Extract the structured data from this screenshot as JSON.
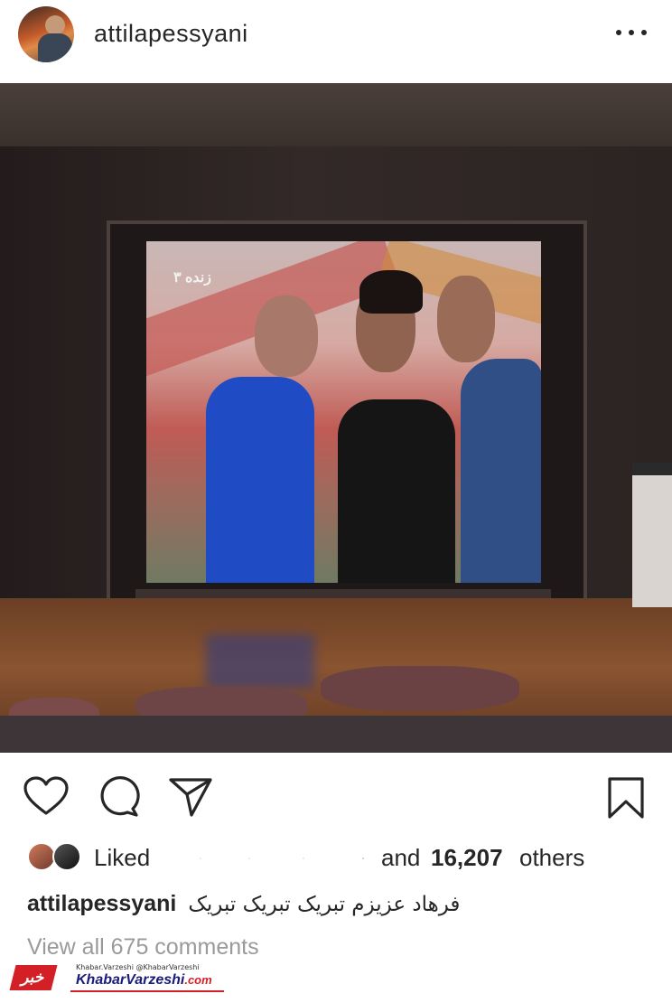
{
  "post": {
    "username": "attilapessyani",
    "more_icon": "more-horizontal-icon"
  },
  "actions": {
    "like_icon": "heart-icon",
    "comment_icon": "comment-icon",
    "share_icon": "send-icon",
    "save_icon": "bookmark-icon"
  },
  "likes": {
    "liked_label": "Liked",
    "and_label": "and",
    "count": "16,207",
    "others_label": "others"
  },
  "caption": {
    "username": "attilapessyani",
    "text": "فرهاد عزیزم تبریک تبریک تبریک"
  },
  "comments": {
    "view_all": "View all 675 comments"
  },
  "watermark": {
    "mark": "خبر",
    "small": "Khabar.Varzeshi  @KhabarVarzeshi",
    "brand": "KhabarVarzeshi",
    "domain": ".com"
  },
  "screen": {
    "channel_logo": "زنده ۳"
  },
  "colors": {
    "text": "#262626",
    "muted": "#9a9a9a",
    "watermark_red": "#d32027",
    "watermark_blue": "#1b1b7a"
  }
}
